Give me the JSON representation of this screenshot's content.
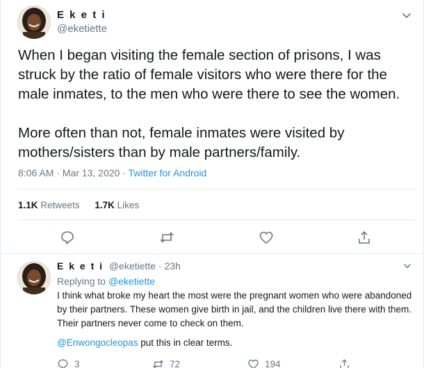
{
  "main_tweet": {
    "author": {
      "name": "E k e t i",
      "handle": "@eketiette"
    },
    "paragraphs": [
      "When I began visiting the female section of prisons, I was struck by the ratio of female visitors who were there for the male inmates, to the men who were there to see the women.",
      "More often than not, female inmates were visited by mothers/sisters than by male partners/family."
    ],
    "time": "8:06 AM · Mar 13, 2020",
    "separator": " · ",
    "source": "Twitter for Android",
    "retweets": {
      "count": "1.1K",
      "label": "Retweets"
    },
    "likes": {
      "count": "1.7K",
      "label": "Likes"
    },
    "actions": [
      "reply-icon",
      "retweet-icon",
      "like-icon",
      "share-icon"
    ]
  },
  "reply_tweet": {
    "author": {
      "name": "E k e t i",
      "handle": "@eketiette",
      "age": "· 23h"
    },
    "replying_label": "Replying to",
    "replying_to": "@eketiette",
    "text": "I think what broke my heart the most were the pregnant women who were abandoned by their partners. These women give birth in jail, and the children live there with them. Their partners never come to check on them.",
    "mention": "@Enwongocleopas",
    "mention_suffix": " put this in clear terms.",
    "reply_count": "3",
    "retweet_count": "72",
    "like_count": "194"
  }
}
